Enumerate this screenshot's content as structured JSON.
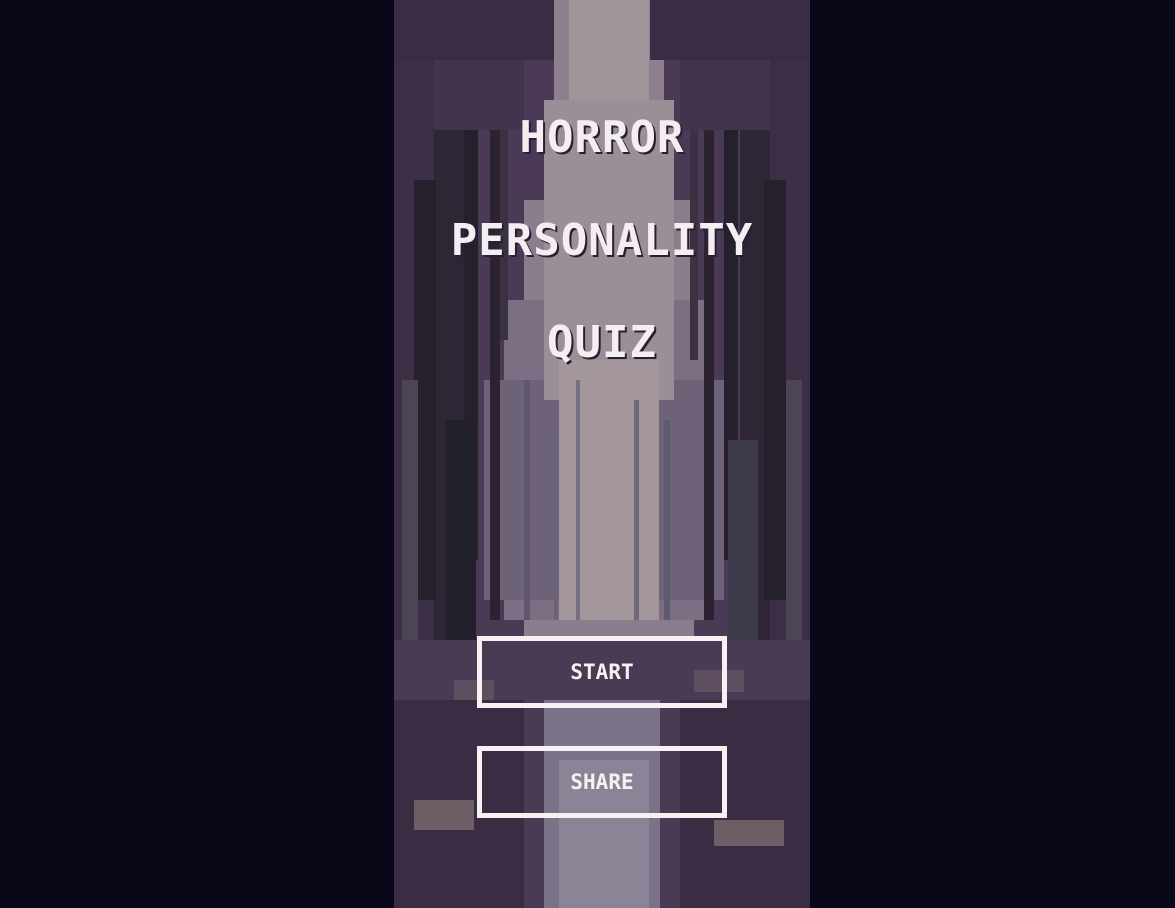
{
  "title": {
    "line1": "HORROR",
    "line2": "PERSONALITY",
    "line3": "QUIZ"
  },
  "buttons": {
    "start_label": "START",
    "share_label": "SHARE"
  },
  "colors": {
    "page_background": "#0a0718",
    "panel_background": "#4a3a55",
    "text": "#f4eef2",
    "button_border": "#f7f1f4"
  }
}
